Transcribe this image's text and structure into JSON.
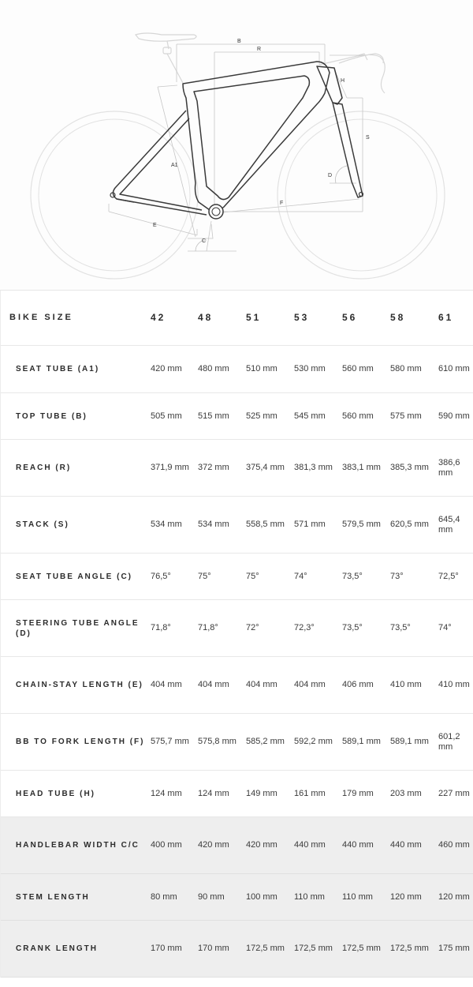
{
  "diagram": {
    "labels": {
      "A1": "A1",
      "B": "B",
      "R": "R",
      "H": "H",
      "S": "S",
      "D": "D",
      "F": "F",
      "E": "E",
      "C": "C"
    }
  },
  "table": {
    "header_label": "BIKE SIZE",
    "sizes": [
      "42",
      "48",
      "51",
      "53",
      "56",
      "58",
      "61"
    ],
    "rows": [
      {
        "label": "SEAT TUBE (A1)",
        "values": [
          "420 mm",
          "480 mm",
          "510 mm",
          "530 mm",
          "560 mm",
          "580 mm",
          "610 mm"
        ]
      },
      {
        "label": "TOP TUBE (B)",
        "values": [
          "505 mm",
          "515 mm",
          "525 mm",
          "545 mm",
          "560 mm",
          "575 mm",
          "590 mm"
        ]
      },
      {
        "label": "REACH (R)",
        "values": [
          "371,9 mm",
          "372 mm",
          "375,4 mm",
          "381,3 mm",
          "383,1 mm",
          "385,3 mm",
          "386,6 mm"
        ]
      },
      {
        "label": "STACK (S)",
        "values": [
          "534 mm",
          "534 mm",
          "558,5 mm",
          "571 mm",
          "579,5 mm",
          "620,5 mm",
          "645,4 mm"
        ]
      },
      {
        "label": "SEAT TUBE ANGLE (C)",
        "values": [
          "76,5°",
          "75°",
          "75°",
          "74°",
          "73,5°",
          "73°",
          "72,5°"
        ]
      },
      {
        "label": "STEERING TUBE ANGLE (D)",
        "values": [
          "71,8°",
          "71,8°",
          "72°",
          "72,3°",
          "73,5°",
          "73,5°",
          "74°"
        ]
      },
      {
        "label": "CHAIN-STAY LENGTH (E)",
        "values": [
          "404 mm",
          "404 mm",
          "404 mm",
          "404 mm",
          "406 mm",
          "410 mm",
          "410 mm"
        ]
      },
      {
        "label": "BB TO FORK LENGTH (F)",
        "values": [
          "575,7 mm",
          "575,8 mm",
          "585,2 mm",
          "592,2 mm",
          "589,1 mm",
          "589,1 mm",
          "601,2 mm"
        ]
      },
      {
        "label": "HEAD TUBE (H)",
        "values": [
          "124 mm",
          "124 mm",
          "149 mm",
          "161 mm",
          "179 mm",
          "203 mm",
          "227 mm"
        ]
      },
      {
        "label": "HANDLEBAR WIDTH C/C",
        "values": [
          "400 mm",
          "420 mm",
          "420 mm",
          "440 mm",
          "440 mm",
          "440 mm",
          "460 mm"
        ]
      },
      {
        "label": "STEM LENGTH",
        "values": [
          "80 mm",
          "90 mm",
          "100 mm",
          "110 mm",
          "110 mm",
          "120 mm",
          "120 mm"
        ]
      },
      {
        "label": "CRANK LENGTH",
        "values": [
          "170 mm",
          "170 mm",
          "172,5 mm",
          "172,5 mm",
          "172,5 mm",
          "172,5 mm",
          "175 mm"
        ]
      }
    ]
  }
}
